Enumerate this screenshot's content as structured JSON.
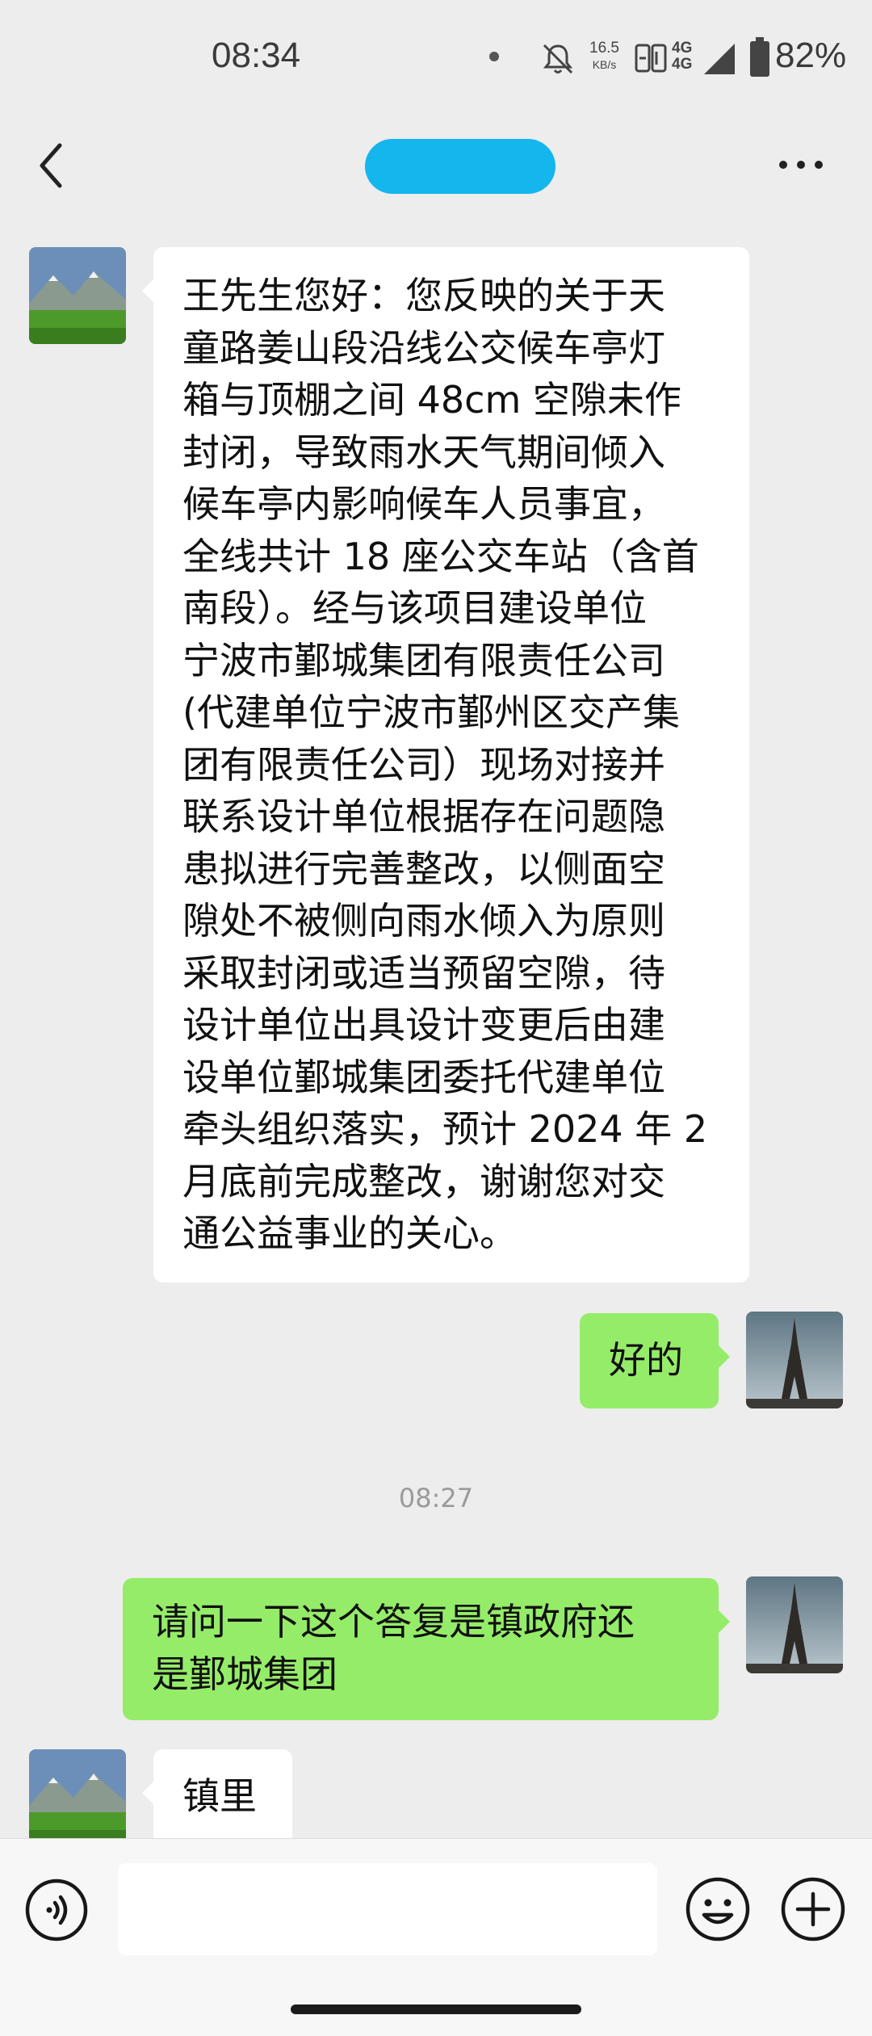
{
  "status_bar": {
    "time": "08:34",
    "speed_value": "16.5",
    "speed_unit": "KB/s",
    "net_top": "4G",
    "net_bottom": "4G",
    "battery": "82%"
  },
  "header": {
    "back_icon": "chevron-left-icon",
    "more_icon": "more-dots-icon"
  },
  "messages": [
    {
      "direction": "incoming",
      "avatar": "mountain-landscape-avatar",
      "lines": [
        "王先生您好：您反映的关于天",
        "童路姜山段沿线公交候车亭灯",
        "箱与顶棚之间 48cm 空隙未作",
        "封闭，导致雨水天气期间倾入",
        "候车亭内影响候车人员事宜，",
        "全线共计 18 座公交车站（含首",
        "南段）。经与该项目建设单位",
        "宁波市鄞城集团有限责任公司",
        "(代建单位宁波市鄞州区交产集",
        "团有限责任公司）现场对接并",
        "联系设计单位根据存在问题隐",
        "患拟进行完善整改，以侧面空",
        "隙处不被侧向雨水倾入为原则",
        "采取封闭或适当预留空隙，待",
        "设计单位出具设计变更后由建",
        "设单位鄞城集团委托代建单位",
        "牵头组织落实，预计 2024 年 2",
        "月底前完成整改，谢谢您对交",
        "通公益事业的关心。"
      ]
    },
    {
      "direction": "outgoing",
      "avatar": "eiffel-tower-avatar",
      "lines": [
        "好的"
      ]
    },
    {
      "direction": "outgoing",
      "avatar": "eiffel-tower-avatar",
      "lines": [
        "请问一下这个答复是镇政府还",
        "是鄞城集团"
      ]
    },
    {
      "direction": "incoming",
      "avatar": "mountain-landscape-avatar",
      "lines": [
        "镇里"
      ]
    }
  ],
  "timestamp": "08:27",
  "input_bar": {
    "voice_icon": "voice-icon",
    "input_value": "",
    "emoji_icon": "emoji-icon",
    "plus_icon": "plus-icon"
  },
  "colors": {
    "background": "#ededed",
    "incoming_bubble": "#ffffff",
    "outgoing_bubble": "#95ec69",
    "title_redaction": "#14b6ee"
  }
}
